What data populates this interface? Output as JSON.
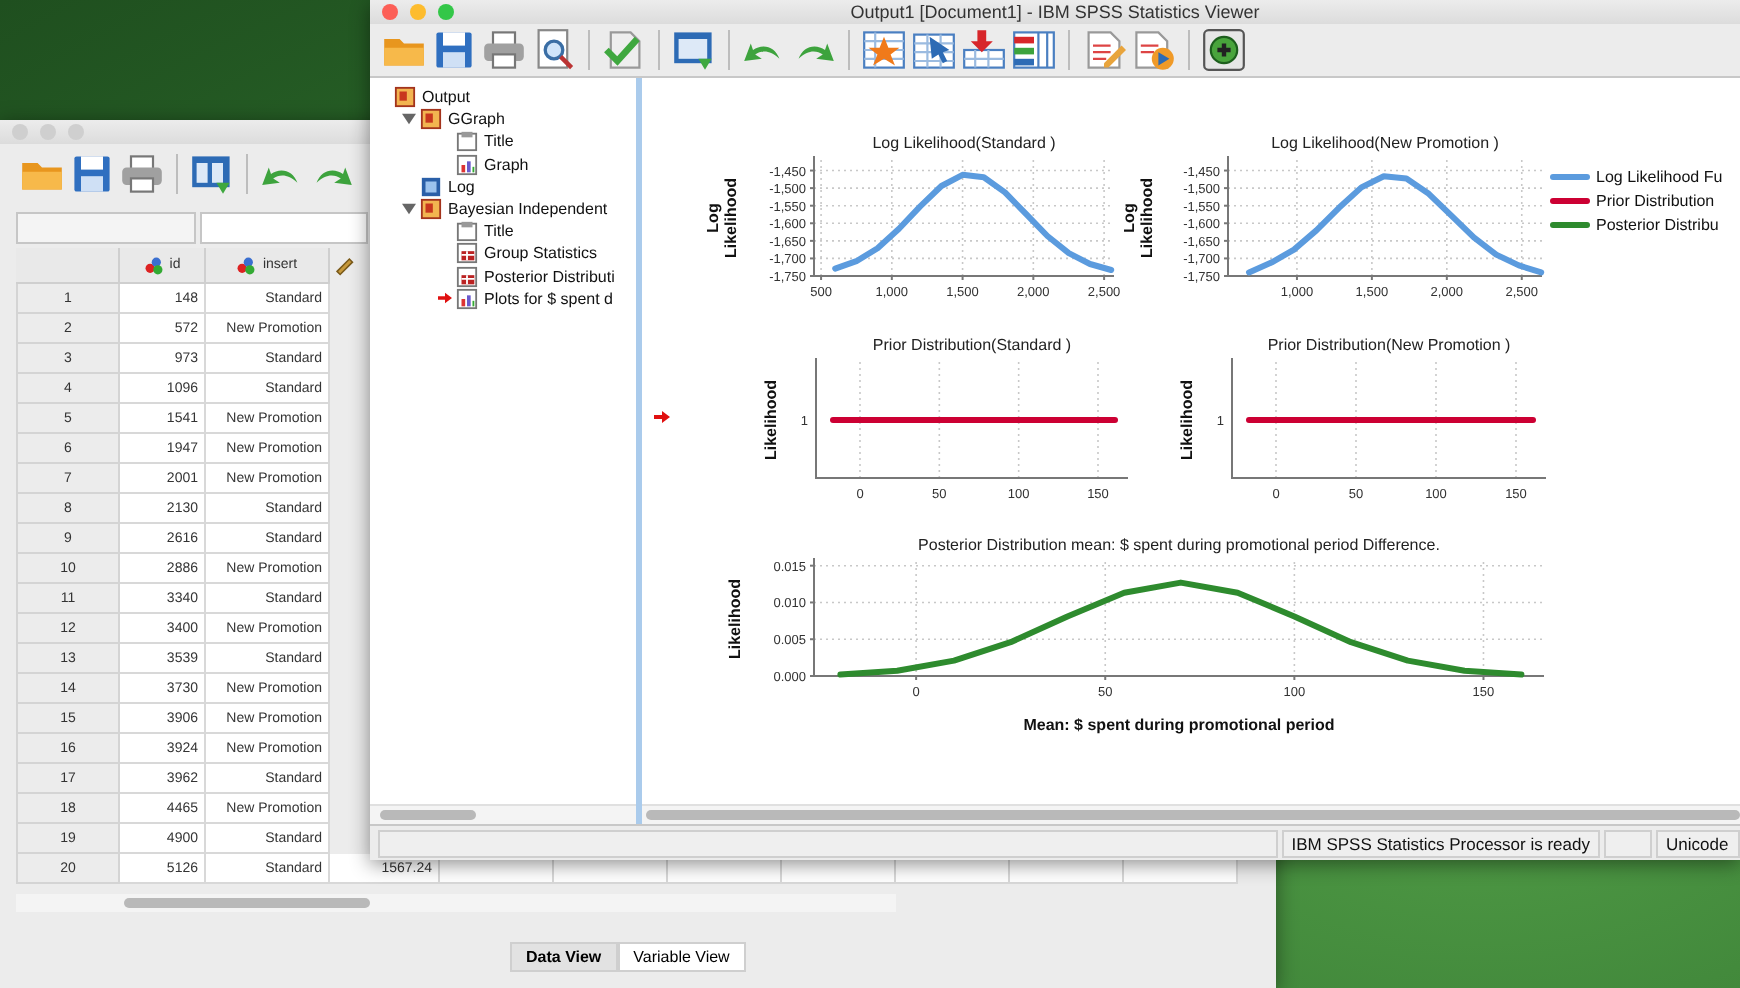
{
  "data_editor": {
    "table": {
      "columns": [
        {
          "label": "id",
          "kind": "nominal"
        },
        {
          "label": "insert",
          "kind": "nominal"
        },
        {
          "kind": "scale"
        }
      ],
      "rows": [
        {
          "number": "1",
          "cells": [
            "148",
            "Standard"
          ]
        },
        {
          "number": "2",
          "cells": [
            "572",
            "New Promotion"
          ]
        },
        {
          "number": "3",
          "cells": [
            "973",
            "Standard"
          ]
        },
        {
          "number": "4",
          "cells": [
            "1096",
            "Standard"
          ]
        },
        {
          "number": "5",
          "cells": [
            "1541",
            "New Promotion"
          ]
        },
        {
          "number": "6",
          "cells": [
            "1947",
            "New Promotion"
          ]
        },
        {
          "number": "7",
          "cells": [
            "2001",
            "New Promotion"
          ]
        },
        {
          "number": "8",
          "cells": [
            "2130",
            "Standard"
          ]
        },
        {
          "number": "9",
          "cells": [
            "2616",
            "Standard"
          ]
        },
        {
          "number": "10",
          "cells": [
            "2886",
            "New Promotion"
          ]
        },
        {
          "number": "11",
          "cells": [
            "3340",
            "Standard"
          ]
        },
        {
          "number": "12",
          "cells": [
            "3400",
            "New Promotion"
          ]
        },
        {
          "number": "13",
          "cells": [
            "3539",
            "Standard"
          ]
        },
        {
          "number": "14",
          "cells": [
            "3730",
            "New Promotion"
          ]
        },
        {
          "number": "15",
          "cells": [
            "3906",
            "New Promotion"
          ]
        },
        {
          "number": "16",
          "cells": [
            "3924",
            "New Promotion"
          ]
        },
        {
          "number": "17",
          "cells": [
            "3962",
            "Standard"
          ]
        },
        {
          "number": "18",
          "cells": [
            "4465",
            "New Promotion"
          ]
        },
        {
          "number": "19",
          "cells": [
            "4900",
            "Standard"
          ]
        },
        {
          "number": "20",
          "cells": [
            "5126",
            "Standard",
            "1567.24"
          ]
        }
      ]
    },
    "view_tabs": [
      {
        "label": "Data View",
        "selected": true
      },
      {
        "label": "Variable View",
        "selected": false
      }
    ]
  },
  "viewer": {
    "title": "Output1 [Document1] - IBM SPSS Statistics Viewer",
    "outline": [
      {
        "label": "Output",
        "kind": "book",
        "current": false,
        "children": [
          {
            "label": "GGraph",
            "kind": "book",
            "expanded": true,
            "current": false,
            "children": [
              {
                "label": "Title",
                "kind": "title",
                "current": false
              },
              {
                "label": "Graph",
                "kind": "graph",
                "current": false
              }
            ]
          },
          {
            "label": "Log",
            "kind": "log",
            "current": false
          },
          {
            "label": "Bayesian Independent",
            "kind": "book",
            "expanded": true,
            "current": false,
            "children": [
              {
                "label": "Title",
                "kind": "title",
                "current": false
              },
              {
                "label": "Group Statistics",
                "kind": "table",
                "current": false
              },
              {
                "label": "Posterior Distributi",
                "kind": "table",
                "current": false
              },
              {
                "label": "Plots for $ spent d",
                "kind": "graph",
                "current": true
              }
            ]
          }
        ]
      }
    ],
    "content": {
      "charts": [
        {
          "chart_data": {
            "type": "line",
            "title": "Log Likelihood(Standard )",
            "ylabel": "Log Likelihood",
            "grid": true,
            "x": [
              600,
              750,
              900,
              1050,
              1200,
              1350,
              1500,
              1650,
              1800,
              1950,
              2100,
              2250,
              2400,
              2550
            ],
            "series": [
              {
                "color": "#5b9bde",
                "values": [
                  -1729,
                  -1708,
                  -1671,
                  -1616,
                  -1552,
                  -1494,
                  -1462,
                  -1469,
                  -1512,
                  -1574,
                  -1636,
                  -1685,
                  -1716,
                  -1733
                ]
              }
            ],
            "xlim": [
              450,
              2570
            ],
            "ylim": [
              -1750,
              -1420
            ],
            "xticks": [
              {
                "value": 500,
                "label": "500"
              },
              {
                "value": 1000,
                "label": "1,000"
              },
              {
                "value": 1500,
                "label": "1,500"
              },
              {
                "value": 2000,
                "label": "2,000"
              },
              {
                "value": 2500,
                "label": "2,500"
              }
            ],
            "yticks": [
              {
                "value": -1450,
                "label": "-1,450"
              },
              {
                "value": -1500,
                "label": "-1,500"
              },
              {
                "value": -1550,
                "label": "-1,550"
              },
              {
                "value": -1600,
                "label": "-1,600"
              },
              {
                "value": -1650,
                "label": "-1,650"
              },
              {
                "value": -1700,
                "label": "-1,700"
              },
              {
                "value": -1750,
                "label": "-1,750"
              }
            ]
          }
        },
        {
          "chart_data": {
            "type": "line",
            "title": "Log Likelihood(New Promotion )",
            "ylabel": "Log Likelihood",
            "grid": true,
            "x": [
              680,
              830,
              980,
              1130,
              1280,
              1430,
              1580,
              1730,
              1880,
              2030,
              2180,
              2330,
              2480,
              2630
            ],
            "series": [
              {
                "color": "#5b9bde",
                "values": [
                  -1740,
                  -1712,
                  -1675,
                  -1620,
                  -1556,
                  -1498,
                  -1466,
                  -1473,
                  -1516,
                  -1578,
                  -1640,
                  -1689,
                  -1720,
                  -1740
                ]
              }
            ],
            "xlim": [
              540,
              2635
            ],
            "ylim": [
              -1750,
              -1420
            ],
            "xticks": [
              {
                "value": 1000,
                "label": "1,000"
              },
              {
                "value": 1500,
                "label": "1,500"
              },
              {
                "value": 2000,
                "label": "2,000"
              },
              {
                "value": 2500,
                "label": "2,500"
              }
            ],
            "yticks": [
              {
                "value": -1450,
                "label": "-1,450"
              },
              {
                "value": -1500,
                "label": "-1,500"
              },
              {
                "value": -1550,
                "label": "-1,550"
              },
              {
                "value": -1600,
                "label": "-1,600"
              },
              {
                "value": -1650,
                "label": "-1,650"
              },
              {
                "value": -1700,
                "label": "-1,700"
              },
              {
                "value": -1750,
                "label": "-1,750"
              }
            ]
          }
        },
        {
          "flat_plot": {
            "title": "Prior Distribution(Standard )",
            "ylabel": "Likelihood",
            "y_tick_label": "1",
            "x_tick_labels": [
              "0",
              "50",
              "100",
              "150"
            ]
          }
        },
        {
          "flat_plot": {
            "title": "Prior Distribution(New Promotion )",
            "ylabel": "Likelihood",
            "y_tick_label": "1",
            "x_tick_labels": [
              "0",
              "50",
              "100",
              "150"
            ]
          }
        },
        {
          "chart_data": {
            "type": "line",
            "title": "Posterior Distribution mean: $ spent during promotional period Difference.",
            "xlabel": "Mean: $ spent during promotional period",
            "ylabel": "Likelihood",
            "grid": true,
            "x": [
              -20,
              -5,
              10,
              25,
              40,
              55,
              70,
              85,
              100,
              115,
              130,
              145,
              160
            ],
            "series": [
              {
                "color": "#2e8b2e",
                "values": [
                  0.0002,
                  0.0007,
                  0.0021,
                  0.0046,
                  0.0081,
                  0.0113,
                  0.0127,
                  0.0113,
                  0.0081,
                  0.0046,
                  0.0021,
                  0.0007,
                  0.0002
                ]
              }
            ],
            "xlim": [
              -27,
              166
            ],
            "ylim": [
              0,
              0.0155
            ],
            "xticks": [
              0,
              50,
              100,
              150
            ],
            "yticks": [
              {
                "value": 0,
                "label": "0.000"
              },
              {
                "value": 0.005,
                "label": "0.005"
              },
              {
                "value": 0.01,
                "label": "0.010"
              },
              {
                "value": 0.015,
                "label": "0.015"
              }
            ]
          }
        }
      ],
      "legend": [
        {
          "label": "Log Likelihood Fu",
          "color": "#5b9bde"
        },
        {
          "label": "Prior Distribution",
          "color": "#cc0033"
        },
        {
          "label": "Posterior Distribu",
          "color": "#2e8b2e"
        }
      ]
    },
    "status_bar": [
      "IBM SPSS Statistics Processor is ready",
      "Unicode"
    ]
  }
}
